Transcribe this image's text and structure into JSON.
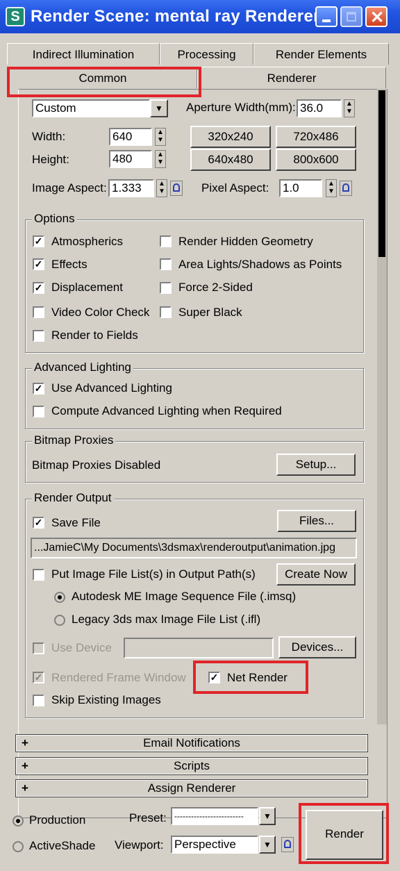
{
  "window": {
    "title": "Render Scene: mental ray Renderer",
    "icon": "3ds-max-icon"
  },
  "tabs": {
    "row1": [
      "Indirect Illumination",
      "Processing",
      "Render Elements"
    ],
    "common": "Common",
    "renderer": "Renderer"
  },
  "output_size": {
    "preset": "Custom",
    "aperture_label": "Aperture Width(mm):",
    "aperture_value": "36.0",
    "width_label": "Width:",
    "width_value": "640",
    "height_label": "Height:",
    "height_value": "480",
    "presets": [
      "320x240",
      "720x486",
      "640x480",
      "800x600"
    ],
    "image_aspect_label": "Image Aspect:",
    "image_aspect_value": "1.333",
    "pixel_aspect_label": "Pixel Aspect:",
    "pixel_aspect_value": "1.0"
  },
  "options": {
    "title": "Options",
    "items": [
      {
        "label": "Atmospherics",
        "checked": true
      },
      {
        "label": "Render Hidden Geometry",
        "checked": false
      },
      {
        "label": "Effects",
        "checked": true
      },
      {
        "label": "Area Lights/Shadows as Points",
        "checked": false
      },
      {
        "label": "Displacement",
        "checked": true
      },
      {
        "label": "Force 2-Sided",
        "checked": false
      },
      {
        "label": "Video Color Check",
        "checked": false
      },
      {
        "label": "Super Black",
        "checked": false
      },
      {
        "label": "Render to Fields",
        "checked": false
      }
    ]
  },
  "advanced_lighting": {
    "title": "Advanced Lighting",
    "use": "Use Advanced Lighting",
    "compute": "Compute Advanced Lighting when Required"
  },
  "bitmap_proxies": {
    "title": "Bitmap Proxies",
    "status": "Bitmap Proxies Disabled",
    "setup": "Setup..."
  },
  "render_output": {
    "title": "Render Output",
    "save_file": "Save File",
    "files_button": "Files...",
    "path": "...JamieC\\My Documents\\3dsmax\\renderoutput\\animation.jpg",
    "put_list": "Put Image File List(s) in Output Path(s)",
    "create_now": "Create Now",
    "autodesk_seq": "Autodesk ME Image Sequence File (.imsq)",
    "legacy_list": "Legacy 3ds max Image File List (.ifl)",
    "use_device": "Use Device",
    "devices_button": "Devices...",
    "rendered_frame_window": "Rendered Frame Window",
    "net_render": "Net Render",
    "skip_existing": "Skip Existing Images"
  },
  "rollouts": [
    "Email Notifications",
    "Scripts",
    "Assign Renderer"
  ],
  "bottom": {
    "production": "Production",
    "activeshade": "ActiveShade",
    "preset_label": "Preset:",
    "preset_value": "-------------------------",
    "viewport_label": "Viewport:",
    "viewport_value": "Perspective",
    "render_button": "Render"
  },
  "colors": {
    "highlight": "#e0252a",
    "titlebar": "#2154e0",
    "panel": "#d4d0c8"
  }
}
